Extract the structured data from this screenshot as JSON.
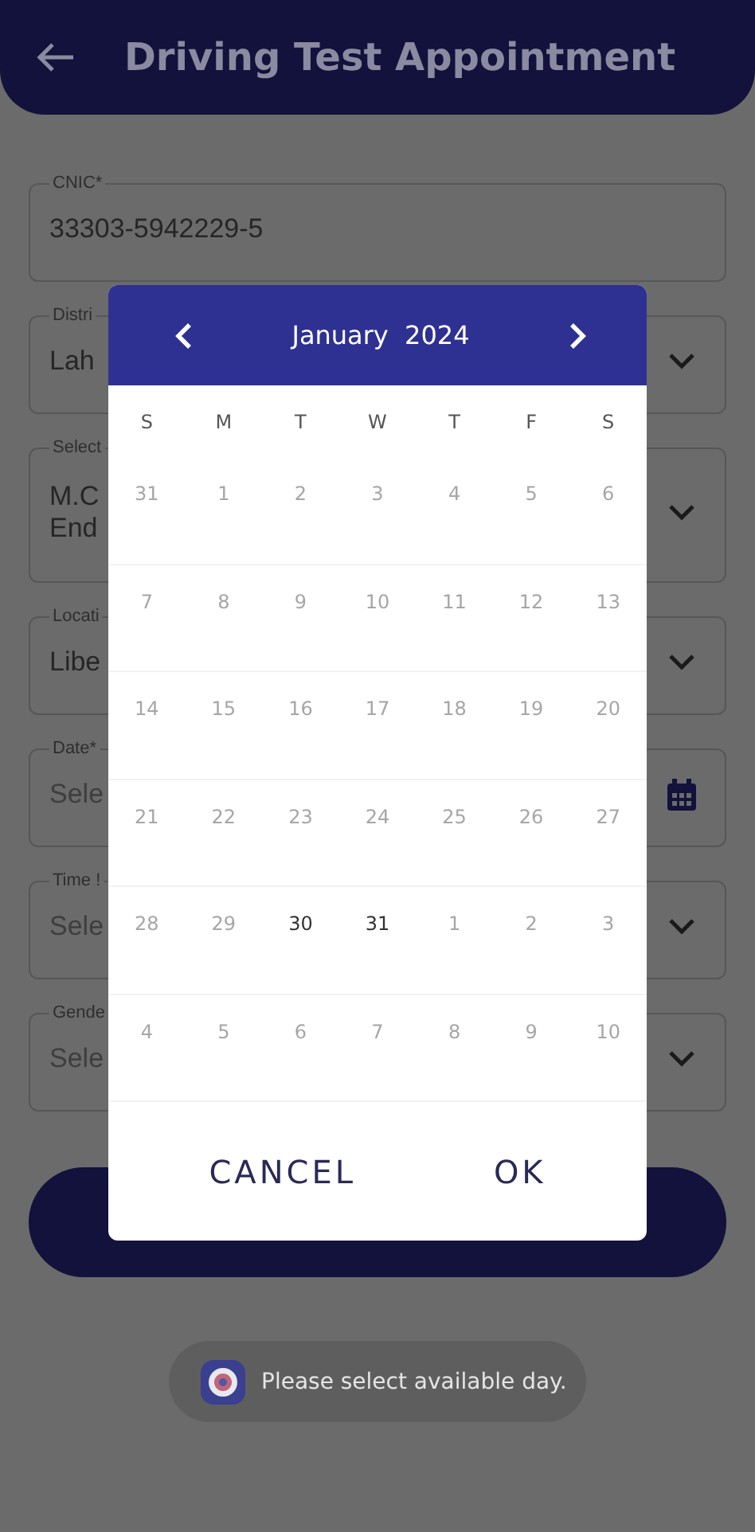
{
  "header": {
    "title": "Driving Test Appointment"
  },
  "form": {
    "fields": [
      {
        "kind": "text",
        "label": "CNIC*",
        "value": "33303-5942229-5"
      },
      {
        "kind": "select",
        "label": "Distri",
        "value": "Lah"
      },
      {
        "kind": "select",
        "label": "Select",
        "value": "M.C\nEnd"
      },
      {
        "kind": "select",
        "label": "Locati",
        "value": "Libe"
      },
      {
        "kind": "date",
        "label": "Date*",
        "placeholder": "Sele"
      },
      {
        "kind": "select",
        "label": "Time !",
        "placeholder": "Sele"
      },
      {
        "kind": "select",
        "label": "Gende",
        "placeholder": "Sele"
      }
    ]
  },
  "date_picker": {
    "month_label": "January  2024",
    "weekdays": [
      "S",
      "M",
      "T",
      "W",
      "T",
      "F",
      "S"
    ],
    "weeks": [
      [
        {
          "day": "31",
          "disabled": true
        },
        {
          "day": "1",
          "disabled": true
        },
        {
          "day": "2",
          "disabled": true
        },
        {
          "day": "3",
          "disabled": true
        },
        {
          "day": "4",
          "disabled": true
        },
        {
          "day": "5",
          "disabled": true
        },
        {
          "day": "6",
          "disabled": true
        }
      ],
      [
        {
          "day": "7",
          "disabled": true
        },
        {
          "day": "8",
          "disabled": true
        },
        {
          "day": "9",
          "disabled": true
        },
        {
          "day": "10",
          "disabled": true
        },
        {
          "day": "11",
          "disabled": true
        },
        {
          "day": "12",
          "disabled": true
        },
        {
          "day": "13",
          "disabled": true
        }
      ],
      [
        {
          "day": "14",
          "disabled": true
        },
        {
          "day": "15",
          "disabled": true
        },
        {
          "day": "16",
          "disabled": true
        },
        {
          "day": "17",
          "disabled": true
        },
        {
          "day": "18",
          "disabled": true
        },
        {
          "day": "19",
          "disabled": true
        },
        {
          "day": "20",
          "disabled": true
        }
      ],
      [
        {
          "day": "21",
          "disabled": true
        },
        {
          "day": "22",
          "disabled": true
        },
        {
          "day": "23",
          "disabled": true
        },
        {
          "day": "24",
          "disabled": true
        },
        {
          "day": "25",
          "disabled": true
        },
        {
          "day": "26",
          "disabled": true
        },
        {
          "day": "27",
          "disabled": true
        }
      ],
      [
        {
          "day": "28",
          "disabled": true
        },
        {
          "day": "29",
          "disabled": true
        },
        {
          "day": "30",
          "disabled": false
        },
        {
          "day": "31",
          "disabled": false
        },
        {
          "day": "1",
          "disabled": true
        },
        {
          "day": "2",
          "disabled": true
        },
        {
          "day": "3",
          "disabled": true
        }
      ],
      [
        {
          "day": "4",
          "disabled": true
        },
        {
          "day": "5",
          "disabled": true
        },
        {
          "day": "6",
          "disabled": true
        },
        {
          "day": "7",
          "disabled": true
        },
        {
          "day": "8",
          "disabled": true
        },
        {
          "day": "9",
          "disabled": true
        },
        {
          "day": "10",
          "disabled": true
        }
      ]
    ],
    "buttons": [
      "CANCEL",
      "OK"
    ]
  },
  "toast": {
    "message": "Please select available day."
  }
}
